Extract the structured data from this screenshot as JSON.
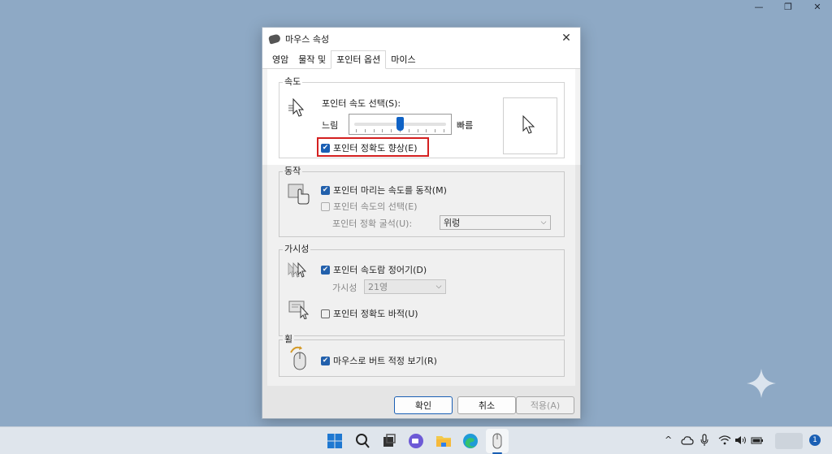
{
  "window_controls": {
    "minimize": "—",
    "restore": "❐",
    "close": "✕"
  },
  "dialog": {
    "title": "마우스 속성",
    "close": "✕",
    "tabs": [
      "영암",
      "물작 및",
      "포인터 옵션",
      "마이스"
    ],
    "active_tab_index": 2
  },
  "speed": {
    "legend": "속도",
    "select_label": "포인터 속도 선택(S):",
    "slow": "느림",
    "fast": "빠름",
    "slider_value_fraction": 0.5,
    "precision": {
      "label": "포인터 정확도 향상(E)",
      "checked": true
    }
  },
  "motion": {
    "legend": "동작",
    "snap": {
      "label": "포인터 마리는 속도를 동작(M)",
      "checked": true
    },
    "speed_option": {
      "label": "포인터 속도의 선택(E)",
      "checked": false
    },
    "precision_label": "포인터 정확 굴석(U):",
    "precision_value": "위렁"
  },
  "visibility": {
    "legend": "가시성",
    "trails": {
      "label": "포인터 속도람 정어기(D)",
      "checked": true
    },
    "trail_label": "가시성",
    "trail_value": "21영",
    "hide": {
      "label": "포인터 정확도 바적(U)",
      "checked": false
    }
  },
  "wheel": {
    "legend": "휠",
    "show_location": {
      "label": "마우스로 버트 적정 보기(R)",
      "checked": true
    }
  },
  "buttons": {
    "ok": "확인",
    "cancel": "취소",
    "apply": "적용(A)"
  },
  "taskbar": {
    "notification_count": "1",
    "tray_chevron": "^"
  },
  "colors": {
    "accent": "#1a5fb4",
    "highlight": "#d42020",
    "desktop": "#8ea9c5"
  }
}
